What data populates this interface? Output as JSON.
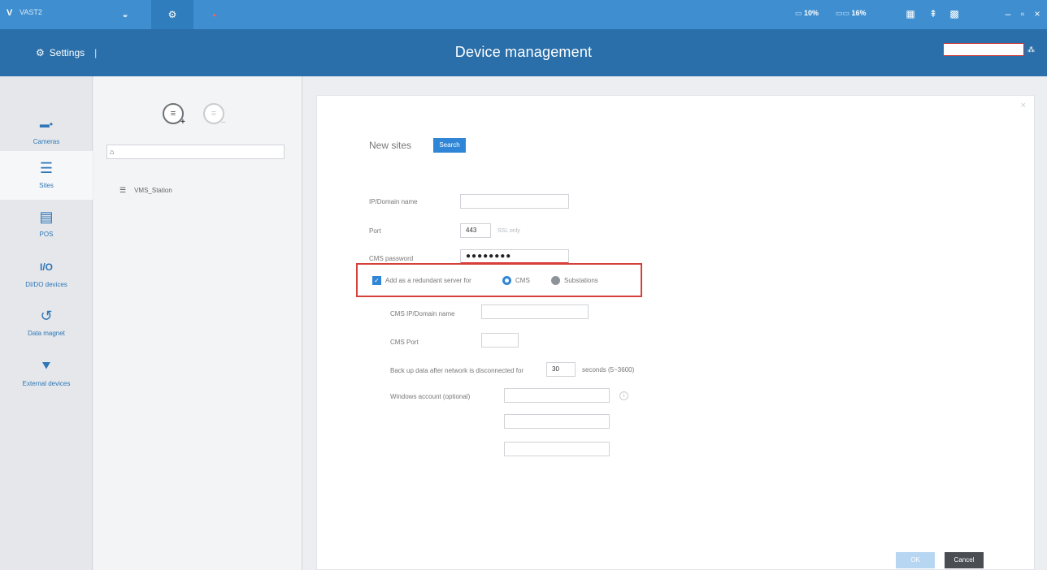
{
  "app": {
    "logo_icon": "vivotek-logo-icon",
    "name": "VAST2"
  },
  "topbar": {
    "tabs": [
      {
        "icon": "liveview-icon",
        "glyph": "◒"
      },
      {
        "icon": "settings-tab-icon",
        "glyph": "⚙"
      }
    ],
    "add_tab_glyph": "▸",
    "stats": [
      {
        "label": "",
        "value": "10%"
      },
      {
        "label": "",
        "value": "16%"
      }
    ],
    "icons": [
      "monitor-icon",
      "help-icon",
      "layout-icon"
    ],
    "window_controls": [
      "–",
      "▫",
      "×"
    ]
  },
  "header": {
    "settings_label": "Settings",
    "title": "Device management"
  },
  "leftnav": {
    "items": [
      {
        "label": "Cameras",
        "icon": "camera-icon",
        "glyph": "▬•"
      },
      {
        "label": "Sites",
        "icon": "sites-icon",
        "glyph": "☰",
        "active": true
      },
      {
        "label": "POS",
        "icon": "pos-icon",
        "glyph": "▤"
      },
      {
        "label": "DI/DO devices",
        "icon": "io-icon",
        "glyph": "I/O"
      },
      {
        "label": "Data magnet",
        "icon": "data-magnet-icon",
        "glyph": "↺"
      },
      {
        "label": "External devices",
        "icon": "external-devices-icon",
        "glyph": "⯆"
      }
    ]
  },
  "sitepanel": {
    "add_site_glyph": "≡",
    "remove_site_glyph": "≡",
    "search_placeholder": "",
    "tree": [
      {
        "label": "VMS_Station",
        "icon": "site-list-icon"
      }
    ]
  },
  "form": {
    "new_sites_label": "New sites",
    "search_button": "Search",
    "ip_label": "IP/Domain name",
    "ip_value": "",
    "port_label": "Port",
    "port_value": "443",
    "port_hint": "SSL only",
    "cms_password_label": "CMS password",
    "cms_password_value": "●●●●●●●●",
    "redundant_label": "Add as a redundant server for",
    "radio_cms": "CMS",
    "radio_substations": "Substations",
    "cms_ip_label": "CMS IP/Domain name",
    "cms_ip_value": "",
    "cms_port_label": "CMS Port",
    "cms_port_value": "",
    "backup_label": "Back up data after network is disconnected for",
    "backup_value": "30",
    "backup_unit": "seconds (5~3600)",
    "windows_label": "Windows account (optional)",
    "windows_value": "",
    "username_placeholder": "",
    "password_placeholder": "",
    "ok_button": "OK",
    "cancel_button": "Cancel"
  },
  "colors": {
    "topbar": "#3f8fd0",
    "header": "#2a6fa9",
    "accent": "#2f86d6",
    "highlight_box": "#d6403a"
  }
}
